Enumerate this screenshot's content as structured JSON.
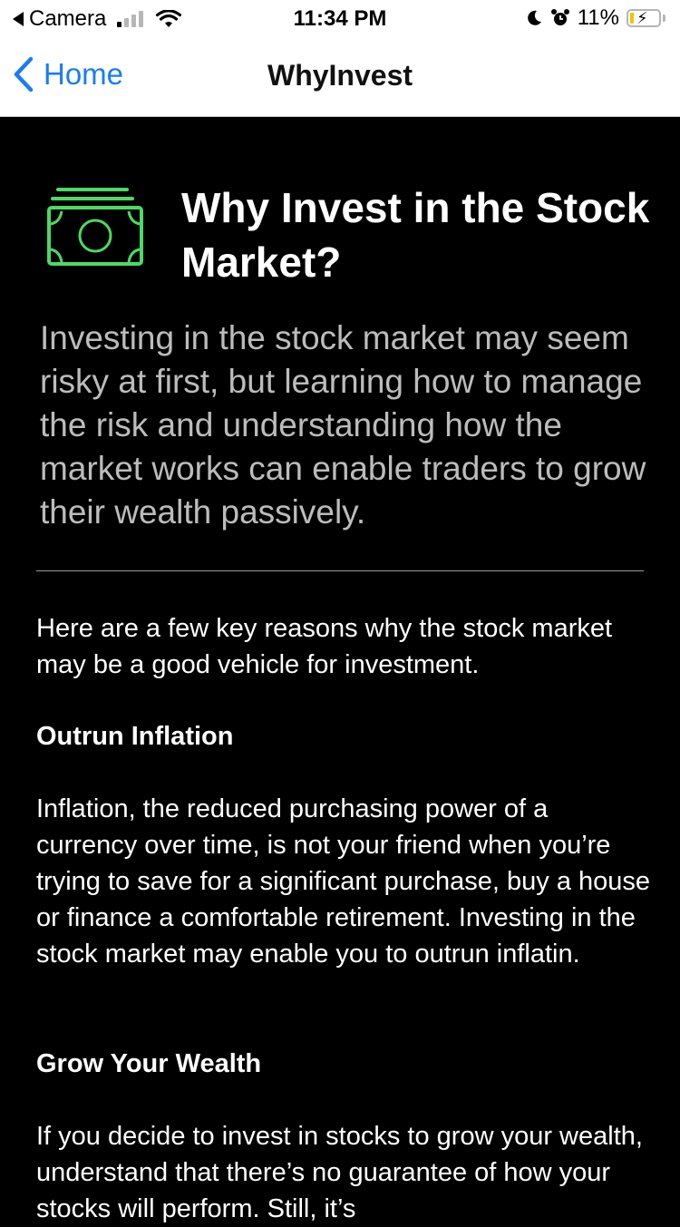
{
  "status_bar": {
    "back_app": "Camera",
    "time": "11:34 PM",
    "battery": "11%",
    "battery_level": 0.11,
    "signal_bars_on": 1,
    "signal_bars_total": 4
  },
  "nav": {
    "back_label": "Home",
    "title": "WhyInvest"
  },
  "article": {
    "title": "Why Invest in the Stock Market?",
    "lead": "Investing in the stock market may seem risky at first, but learning how to manage the risk and understanding how the market works can enable traders to grow their wealth passively.",
    "intro": "Here are a few key reasons why the stock market may be a good vehicle for investment.",
    "sections": [
      {
        "heading": "Outrun Inflation",
        "body": "Inflation, the reduced purchasing power of a currency over time, is not your friend when you’re trying to save for a significant purchase, buy a house or finance a comfortable retirement. Investing in the stock market may enable you to outrun inflatin."
      },
      {
        "heading": "Grow Your Wealth",
        "body": "If you decide to invest in stocks to grow your wealth, understand that there’s no guarantee of how your stocks will perform. Still, it’s"
      }
    ]
  },
  "colors": {
    "accent": "#1a7cf5",
    "icon_green": "#4cd964",
    "background": "#000000",
    "lead_text": "#bcbcbc"
  },
  "icons": {
    "hero": "money-bills-icon",
    "back": "chevron-left-icon"
  }
}
